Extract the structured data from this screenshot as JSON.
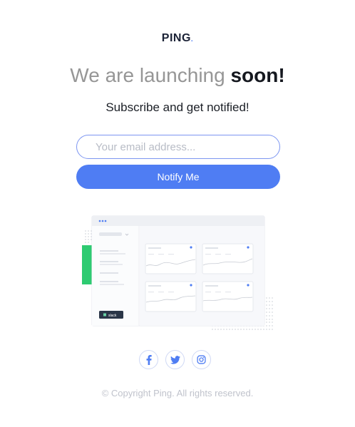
{
  "brand": {
    "name": "PING",
    "dot": "."
  },
  "hero": {
    "headline_light": "We are launching ",
    "headline_bold": "soon!",
    "subline": "Subscribe and get notified!"
  },
  "form": {
    "email_placeholder": "Your email address...",
    "email_value": "",
    "submit_label": "Notify Me"
  },
  "illustration": {
    "app_badge": "slack"
  },
  "social": [
    {
      "icon": "facebook-icon"
    },
    {
      "icon": "twitter-icon"
    },
    {
      "icon": "instagram-icon"
    }
  ],
  "footer": {
    "copyright": "© Copyright Ping. All rights reserved."
  },
  "colors": {
    "accent": "#4f7df3",
    "dark": "#15181f",
    "muted": "#969696",
    "green": "#2ecb71"
  }
}
